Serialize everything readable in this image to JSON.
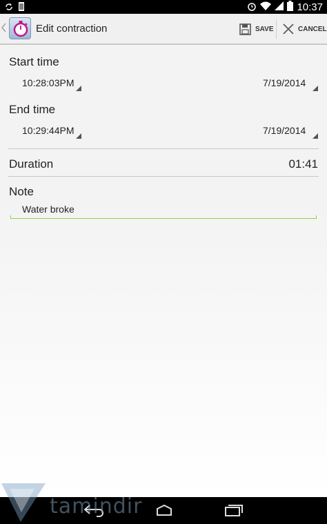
{
  "status_bar": {
    "time": "10:37"
  },
  "action_bar": {
    "title": "Edit contraction",
    "save_label": "SAVE",
    "cancel_label": "CANCEL"
  },
  "start": {
    "label": "Start time",
    "time": "10:28:03PM",
    "date": "7/19/2014"
  },
  "end": {
    "label": "End time",
    "time": "10:29:44PM",
    "date": "7/19/2014"
  },
  "duration": {
    "label": "Duration",
    "value": "01:41"
  },
  "note": {
    "label": "Note",
    "value": "Water broke"
  },
  "watermark": "tamindir",
  "colors": {
    "accent_underline": "#8fd04f",
    "action_bar_bg": "#f0f0f0"
  }
}
